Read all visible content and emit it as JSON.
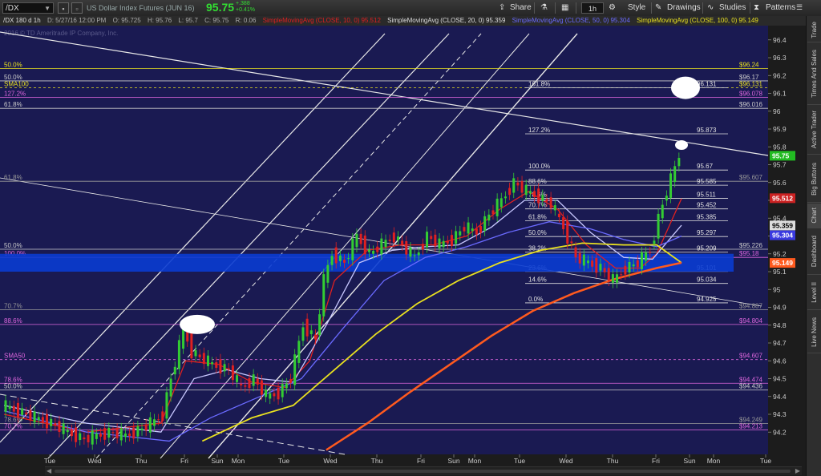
{
  "toolbar": {
    "symbol": "/DX",
    "description": "US Dollar Index Futures (JUN 16)",
    "last_price": "95.75",
    "change_abs": "+.388",
    "change_pct": "+0.41%",
    "share": "Share",
    "timeframe": "1h",
    "style": "Style",
    "drawings": "Drawings",
    "studies": "Studies",
    "patterns": "Patterns"
  },
  "info_bar": {
    "label": "/DX 180 d 1h",
    "date": "D: 5/27/16 12:00 PM",
    "open": "O: 95.725",
    "high": "H: 95.76",
    "low": "L: 95.7",
    "close": "C: 95.75",
    "range": "R: 0.06",
    "sma10": "SimpleMovingAvg (CLOSE, 10, 0)",
    "sma10_val": "95.512",
    "sma20": "SimpleMovingAvg (CLOSE, 20, 0)",
    "sma20_val": "95.359",
    "sma50": "SimpleMovingAvg (CLOSE, 50, 0)",
    "sma50_val": "95.304",
    "sma100": "SimpleMovingAvg (CLOSE, 100, 0)",
    "sma100_val": "95.149"
  },
  "watermark": "2016 © TD Ameritrade IP Company, Inc.",
  "sidebar_tabs": [
    "Trade",
    "Times And Sales",
    "Active Trader",
    "Big Buttons",
    "Chart",
    "Dashboard",
    "Level II",
    "Live News"
  ],
  "colors": {
    "background": "#1a1a52",
    "sma10": "#e02020",
    "sma20": "#c8c8ff",
    "sma50": "#6a6aff",
    "sma100": "#e8e020",
    "sma200": "#ff5a1e",
    "price_up": "#33cc33",
    "price_down": "#e02020",
    "support_band": "#0a3cd2"
  },
  "chart_data": {
    "type": "line",
    "title": "",
    "ylim": [
      94.1,
      96.5
    ],
    "y_ticks": [
      "96.4",
      "96.3",
      "96.2",
      "96.1",
      "96",
      "95.9",
      "95.8",
      "95.7",
      "95.6",
      "95.5",
      "95.4",
      "95.3",
      "95.2",
      "95.1",
      "95",
      "94.9",
      "94.8",
      "94.7",
      "94.6",
      "94.5",
      "94.4",
      "94.3",
      "94.2"
    ],
    "x_labels": [
      "Tue",
      "Wed",
      "Thu",
      "Fri",
      "Sun",
      "Mon",
      "Tue",
      "Wed",
      "Thu",
      "Fri",
      "Sun",
      "Mon",
      "Tue",
      "Wed",
      "Thu",
      "Fri",
      "Sun",
      "Mon",
      "Tue"
    ],
    "price_series": [
      {
        "t": 0,
        "y": 94.35
      },
      {
        "t": 4,
        "y": 94.32
      },
      {
        "t": 8,
        "y": 94.28
      },
      {
        "t": 12,
        "y": 94.25
      },
      {
        "t": 16,
        "y": 94.2
      },
      {
        "t": 20,
        "y": 94.16
      },
      {
        "t": 26,
        "y": 94.2
      },
      {
        "t": 30,
        "y": 94.18
      },
      {
        "t": 34,
        "y": 94.22
      },
      {
        "t": 37,
        "y": 94.26
      },
      {
        "t": 39,
        "y": 94.3
      },
      {
        "t": 41,
        "y": 94.5
      },
      {
        "t": 43,
        "y": 94.68
      },
      {
        "t": 44,
        "y": 94.79
      },
      {
        "t": 46,
        "y": 94.65
      },
      {
        "t": 48,
        "y": 94.62
      },
      {
        "t": 51,
        "y": 94.58
      },
      {
        "t": 55,
        "y": 94.55
      },
      {
        "t": 58,
        "y": 94.45
      },
      {
        "t": 61,
        "y": 94.5
      },
      {
        "t": 64,
        "y": 94.4
      },
      {
        "t": 67,
        "y": 94.42
      },
      {
        "t": 70,
        "y": 94.5
      },
      {
        "t": 73,
        "y": 94.8
      },
      {
        "t": 76,
        "y": 94.72
      },
      {
        "t": 78,
        "y": 95.05
      },
      {
        "t": 80,
        "y": 95.2
      },
      {
        "t": 83,
        "y": 95.15
      },
      {
        "t": 86,
        "y": 95.3
      },
      {
        "t": 89,
        "y": 95.2
      },
      {
        "t": 92,
        "y": 95.25
      },
      {
        "t": 95,
        "y": 95.3
      },
      {
        "t": 98,
        "y": 95.22
      },
      {
        "t": 100,
        "y": 95.18
      },
      {
        "t": 103,
        "y": 95.3
      },
      {
        "t": 106,
        "y": 95.25
      },
      {
        "t": 109,
        "y": 95.28
      },
      {
        "t": 112,
        "y": 95.35
      },
      {
        "t": 115,
        "y": 95.32
      },
      {
        "t": 118,
        "y": 95.42
      },
      {
        "t": 121,
        "y": 95.5
      },
      {
        "t": 124,
        "y": 95.6
      },
      {
        "t": 127,
        "y": 95.55
      },
      {
        "t": 130,
        "y": 95.52
      },
      {
        "t": 133,
        "y": 95.48
      },
      {
        "t": 136,
        "y": 95.35
      },
      {
        "t": 139,
        "y": 95.18
      },
      {
        "t": 142,
        "y": 95.15
      },
      {
        "t": 145,
        "y": 95.12
      },
      {
        "t": 148,
        "y": 95.05
      },
      {
        "t": 151,
        "y": 95.12
      },
      {
        "t": 154,
        "y": 95.15
      },
      {
        "t": 157,
        "y": 95.22
      },
      {
        "t": 159,
        "y": 95.4
      },
      {
        "t": 161,
        "y": 95.55
      },
      {
        "t": 163,
        "y": 95.68
      },
      {
        "t": 164,
        "y": 95.75
      }
    ],
    "moving_averages": [
      {
        "name": "SMA10",
        "color": "#e02020",
        "values": [
          [
            0,
            94.3
          ],
          [
            20,
            94.2
          ],
          [
            38,
            94.25
          ],
          [
            44,
            94.6
          ],
          [
            52,
            94.58
          ],
          [
            60,
            94.48
          ],
          [
            68,
            94.45
          ],
          [
            74,
            94.6
          ],
          [
            80,
            95.05
          ],
          [
            88,
            95.22
          ],
          [
            96,
            95.25
          ],
          [
            104,
            95.25
          ],
          [
            112,
            95.3
          ],
          [
            120,
            95.45
          ],
          [
            127,
            95.55
          ],
          [
            134,
            95.45
          ],
          [
            141,
            95.25
          ],
          [
            148,
            95.12
          ],
          [
            154,
            95.12
          ],
          [
            158,
            95.2
          ],
          [
            164,
            95.51
          ]
        ]
      },
      {
        "name": "SMA20",
        "color": "#c8c8ff",
        "values": [
          [
            0,
            94.35
          ],
          [
            20,
            94.25
          ],
          [
            38,
            94.2
          ],
          [
            46,
            94.5
          ],
          [
            54,
            94.55
          ],
          [
            62,
            94.5
          ],
          [
            70,
            94.48
          ],
          [
            78,
            94.8
          ],
          [
            86,
            95.15
          ],
          [
            94,
            95.22
          ],
          [
            102,
            95.24
          ],
          [
            110,
            95.25
          ],
          [
            118,
            95.35
          ],
          [
            126,
            95.5
          ],
          [
            134,
            95.5
          ],
          [
            142,
            95.32
          ],
          [
            150,
            95.18
          ],
          [
            157,
            95.17
          ],
          [
            164,
            95.36
          ]
        ]
      },
      {
        "name": "SMA50",
        "color": "#6a6aff",
        "values": [
          [
            0,
            94.32
          ],
          [
            20,
            94.2
          ],
          [
            40,
            94.15
          ],
          [
            50,
            94.28
          ],
          [
            62,
            94.4
          ],
          [
            72,
            94.5
          ],
          [
            82,
            94.78
          ],
          [
            92,
            95.05
          ],
          [
            102,
            95.18
          ],
          [
            112,
            95.24
          ],
          [
            122,
            95.32
          ],
          [
            132,
            95.38
          ],
          [
            142,
            95.34
          ],
          [
            150,
            95.28
          ],
          [
            158,
            95.24
          ],
          [
            164,
            95.3
          ]
        ]
      },
      {
        "name": "SMA100",
        "color": "#e8e020",
        "values": [
          [
            48,
            94.15
          ],
          [
            60,
            94.28
          ],
          [
            70,
            94.35
          ],
          [
            80,
            94.55
          ],
          [
            90,
            94.75
          ],
          [
            100,
            94.92
          ],
          [
            110,
            95.05
          ],
          [
            120,
            95.15
          ],
          [
            130,
            95.22
          ],
          [
            140,
            95.26
          ],
          [
            150,
            95.25
          ],
          [
            158,
            95.25
          ],
          [
            164,
            95.15
          ]
        ]
      },
      {
        "name": "SMA200",
        "color": "#ff5a1e",
        "values": [
          [
            78,
            94.1
          ],
          [
            88,
            94.25
          ],
          [
            98,
            94.42
          ],
          [
            108,
            94.58
          ],
          [
            118,
            94.74
          ],
          [
            128,
            94.88
          ],
          [
            138,
            94.98
          ],
          [
            148,
            95.06
          ],
          [
            158,
            95.12
          ],
          [
            164,
            95.15
          ]
        ]
      }
    ],
    "fib_right": [
      {
        "label": "161.8%",
        "price": "96.131",
        "y": 96.131
      },
      {
        "label": "127.2%",
        "price": "95.873",
        "y": 95.873
      },
      {
        "label": "100.0%",
        "price": "95.67",
        "y": 95.67
      },
      {
        "label": "88.6%",
        "price": "95.585",
        "y": 95.585
      },
      {
        "label": "78.6%",
        "price": "95.511",
        "y": 95.511
      },
      {
        "label": "70.7%",
        "price": "95.452",
        "y": 95.452
      },
      {
        "label": "61.8%",
        "price": "95.385",
        "y": 95.385
      },
      {
        "label": "50.0%",
        "price": "95.297",
        "y": 95.297
      },
      {
        "label": "38.2%",
        "price": "95.209",
        "y": 95.209
      },
      {
        "label": "23.6%",
        "price": "95.101",
        "y": 95.101
      },
      {
        "label": "14.6%",
        "price": "95.034",
        "y": 95.034
      },
      {
        "label": "0.0%",
        "price": "94.925",
        "y": 94.925
      }
    ],
    "levels_left": [
      {
        "label": "50.0%",
        "price": "$96.24",
        "y": 96.24,
        "color": "#e8e020"
      },
      {
        "label": "50.0%",
        "price": "$96.17",
        "y": 96.17,
        "color": "#cccccc"
      },
      {
        "label": "SMA100",
        "price": "$96.131",
        "y": 96.131,
        "color": "#e8e020"
      },
      {
        "label": "127.2%",
        "price": "$96.078",
        "y": 96.078,
        "color": "#dd66dd"
      },
      {
        "label": "61.8%",
        "price": "$96.016",
        "y": 96.016,
        "color": "#cccccc"
      },
      {
        "label": "61.8%",
        "price": "$95.607",
        "y": 95.607,
        "color": "#999999"
      },
      {
        "label": "50.0%",
        "price": "$95.226",
        "y": 95.226,
        "color": "#cccccc"
      },
      {
        "label": "100.0%",
        "price": "$95.18",
        "y": 95.18,
        "color": "#dd66dd"
      },
      {
        "label": "70.7%",
        "price": "$94.887",
        "y": 94.887,
        "color": "#999999"
      },
      {
        "label": "88.6%",
        "price": "$94.804",
        "y": 94.804,
        "color": "#dd66dd"
      },
      {
        "label": "SMA50",
        "price": "$94.607",
        "y": 94.607,
        "color": "#dd66dd"
      },
      {
        "label": "78.6%",
        "price": "$94.474",
        "y": 94.474,
        "color": "#dd66dd"
      },
      {
        "label": "50.0%",
        "price": "$94.436",
        "y": 94.436,
        "color": "#cccccc"
      },
      {
        "label": "78.6%",
        "price": "$94.249",
        "y": 94.249,
        "color": "#999999"
      },
      {
        "label": "70.7%",
        "price": "$94.213",
        "y": 94.213,
        "color": "#dd66dd"
      }
    ],
    "price_tags": [
      {
        "text": "95.75",
        "y": 95.75,
        "bg": "#22bb22"
      },
      {
        "text": "95.512",
        "y": 95.512,
        "bg": "#cc2222"
      },
      {
        "text": "95.359",
        "y": 95.359,
        "bg": "#dddddd"
      },
      {
        "text": "95.304",
        "y": 95.304,
        "bg": "#3a3ae0"
      },
      {
        "text": "95.149",
        "y": 95.149,
        "bg": "#ff5a1e"
      }
    ],
    "support_zone": [
      95.1,
      95.2
    ]
  }
}
